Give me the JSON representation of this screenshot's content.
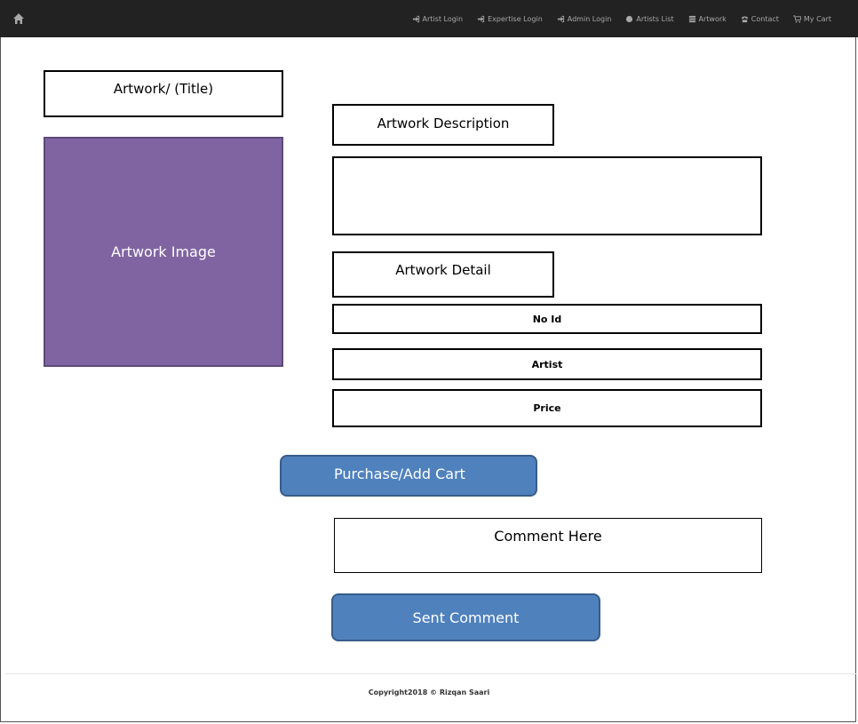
{
  "nav": {
    "home_icon": "home-icon",
    "items": [
      {
        "label": "Artist Login",
        "icon": "login-icon"
      },
      {
        "label": "Expertise Login",
        "icon": "login-icon"
      },
      {
        "label": "Admin Login",
        "icon": "login-icon"
      },
      {
        "label": "Artists List",
        "icon": "globe-icon"
      },
      {
        "label": "Artwork",
        "icon": "list-icon"
      },
      {
        "label": "Contact",
        "icon": "phone-icon"
      },
      {
        "label": "My Cart",
        "icon": "cart-icon"
      }
    ]
  },
  "main": {
    "title": "Artwork/ (Title)",
    "image_label": "Artwork Image",
    "description_heading": "Artwork Description",
    "description_text": "",
    "detail_heading": "Artwork Detail",
    "fields": {
      "id": "No Id",
      "artist": "Artist",
      "price": "Price"
    },
    "purchase_button": "Purchase/Add Cart",
    "comment_placeholder": "Comment Here",
    "send_button": "Sent Comment"
  },
  "footer": {
    "copyright": "Copyright2018 © Rizqan Saari"
  },
  "colors": {
    "navbar": "#222222",
    "image_fill": "#8064a2",
    "button_fill": "#4f81bd",
    "button_border": "#385d8a"
  }
}
